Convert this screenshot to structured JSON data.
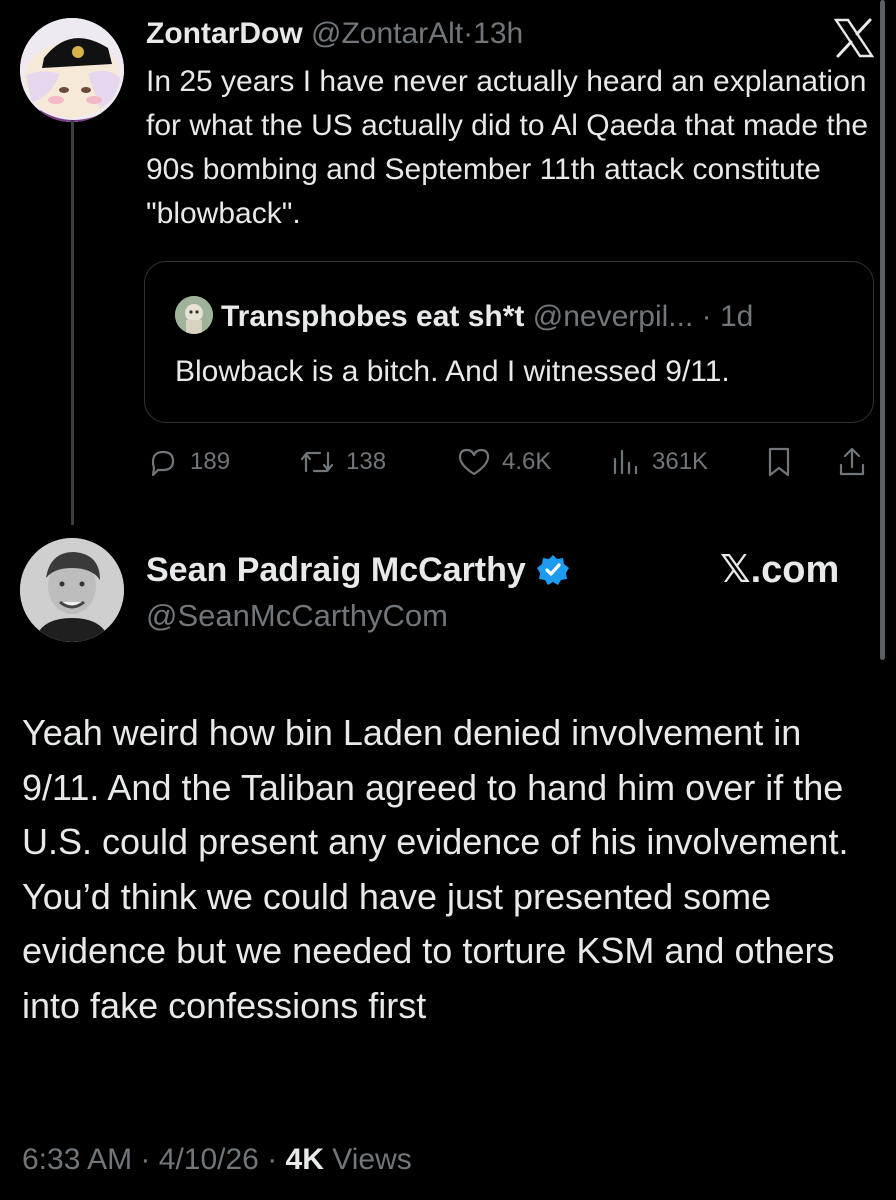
{
  "tweet1": {
    "name": "ZontarDow",
    "handle": "@ZontarAlt",
    "separator": "·",
    "time": "13h",
    "body": "In 25 years I have never actually heard an explanation for what the US actually did to Al Qaeda that made the 90s bombing and September 11th attack constitute \"blowback\".",
    "quote": {
      "name": "Transphobes eat sh*t",
      "handle": "@neverpil...",
      "separator": "·",
      "time": "1d",
      "body": "Blowback is a bitch. And I witnessed 9/11."
    },
    "actions": {
      "replies": "189",
      "reposts": "138",
      "likes": "4.6K",
      "views": "361K"
    },
    "icons": [
      "x-logo-icon",
      "reply-icon",
      "repost-icon",
      "like-icon",
      "views-icon",
      "bookmark-icon",
      "share-icon"
    ]
  },
  "tweet2": {
    "name": "Sean Padraig McCarthy",
    "handle": "@SeanMcCarthyCom",
    "brand": "𝕏.com",
    "body": "Yeah weird how bin Laden denied involvement in 9/11. And the Taliban agreed to hand him over if the U.S. could present any evidence of his involvement. You’d think we could have just presented some evidence but we needed to torture KSM and others into fake confessions first",
    "time": "6:33 AM",
    "date": "4/10/26",
    "separator": "·",
    "views_count": "4K",
    "views_label": "Views",
    "icons": [
      "verified-badge-icon"
    ]
  },
  "colors": {
    "background": "#000000",
    "text": "#e7e9ea",
    "muted": "#71767b",
    "border": "#2f3336",
    "verified": "#1d9bf0"
  }
}
